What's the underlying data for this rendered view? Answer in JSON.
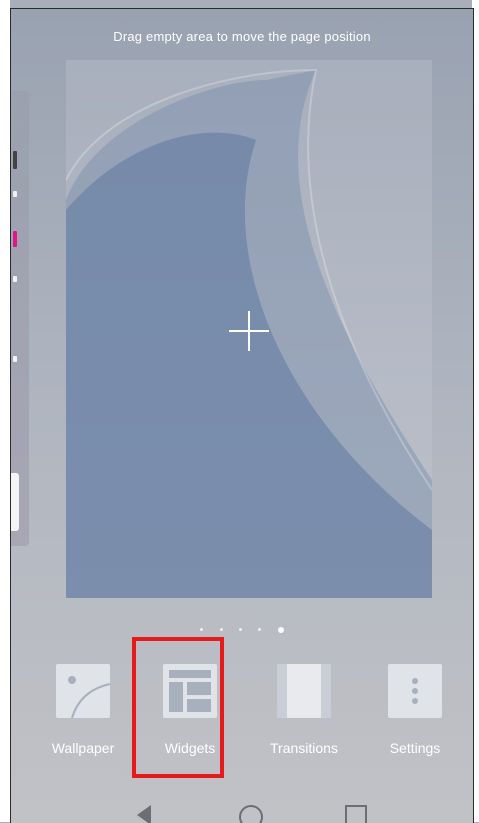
{
  "hint": "Drag empty area to move the page position",
  "page_indicator": {
    "count": 5,
    "active_index": 4
  },
  "menu": [
    {
      "label": "Wallpaper",
      "icon": "wallpaper-icon"
    },
    {
      "label": "Widgets",
      "icon": "widgets-icon"
    },
    {
      "label": "Transitions",
      "icon": "transitions-icon"
    },
    {
      "label": "Settings",
      "icon": "settings-icon"
    }
  ],
  "highlight": {
    "target": "Widgets",
    "color": "#e51b1b"
  },
  "nav": [
    "back-icon",
    "home-icon",
    "recent-apps-icon"
  ]
}
